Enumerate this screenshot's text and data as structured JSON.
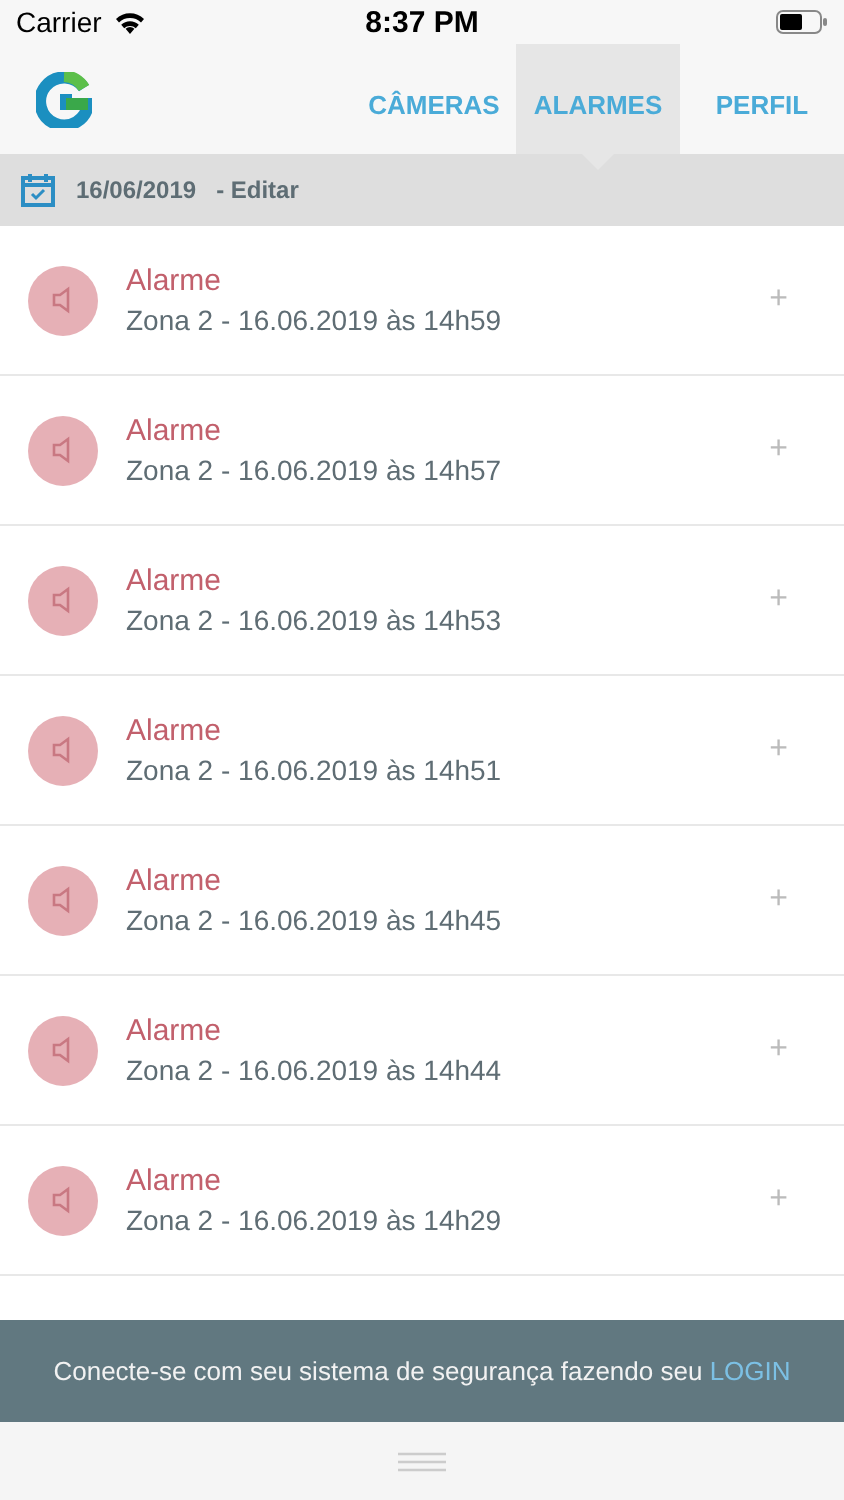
{
  "status_bar": {
    "carrier": "Carrier",
    "time": "8:37 PM"
  },
  "tabs": [
    {
      "label": "CÂMERAS",
      "selected": false
    },
    {
      "label": "ALARMES",
      "selected": true
    },
    {
      "label": "PERFIL",
      "selected": false
    }
  ],
  "date_bar": {
    "date": "16/06/2019",
    "action": "- Editar"
  },
  "alarms": [
    {
      "title": "Alarme",
      "detail": "Zona 2 - 16.06.2019 às 14h59",
      "expand": "+"
    },
    {
      "title": "Alarme",
      "detail": "Zona 2 - 16.06.2019 às 14h57",
      "expand": "+"
    },
    {
      "title": "Alarme",
      "detail": "Zona 2 - 16.06.2019 às 14h53",
      "expand": "+"
    },
    {
      "title": "Alarme",
      "detail": "Zona 2 - 16.06.2019 às 14h51",
      "expand": "+"
    },
    {
      "title": "Alarme",
      "detail": "Zona 2 - 16.06.2019 às 14h45",
      "expand": "+"
    },
    {
      "title": "Alarme",
      "detail": "Zona 2 - 16.06.2019 às 14h44",
      "expand": "+"
    },
    {
      "title": "Alarme",
      "detail": "Zona 2 - 16.06.2019 às 14h29",
      "expand": "+"
    }
  ],
  "login_banner": {
    "text": "Conecte-se com seu sistema de segurança fazendo seu",
    "link": "LOGIN"
  }
}
